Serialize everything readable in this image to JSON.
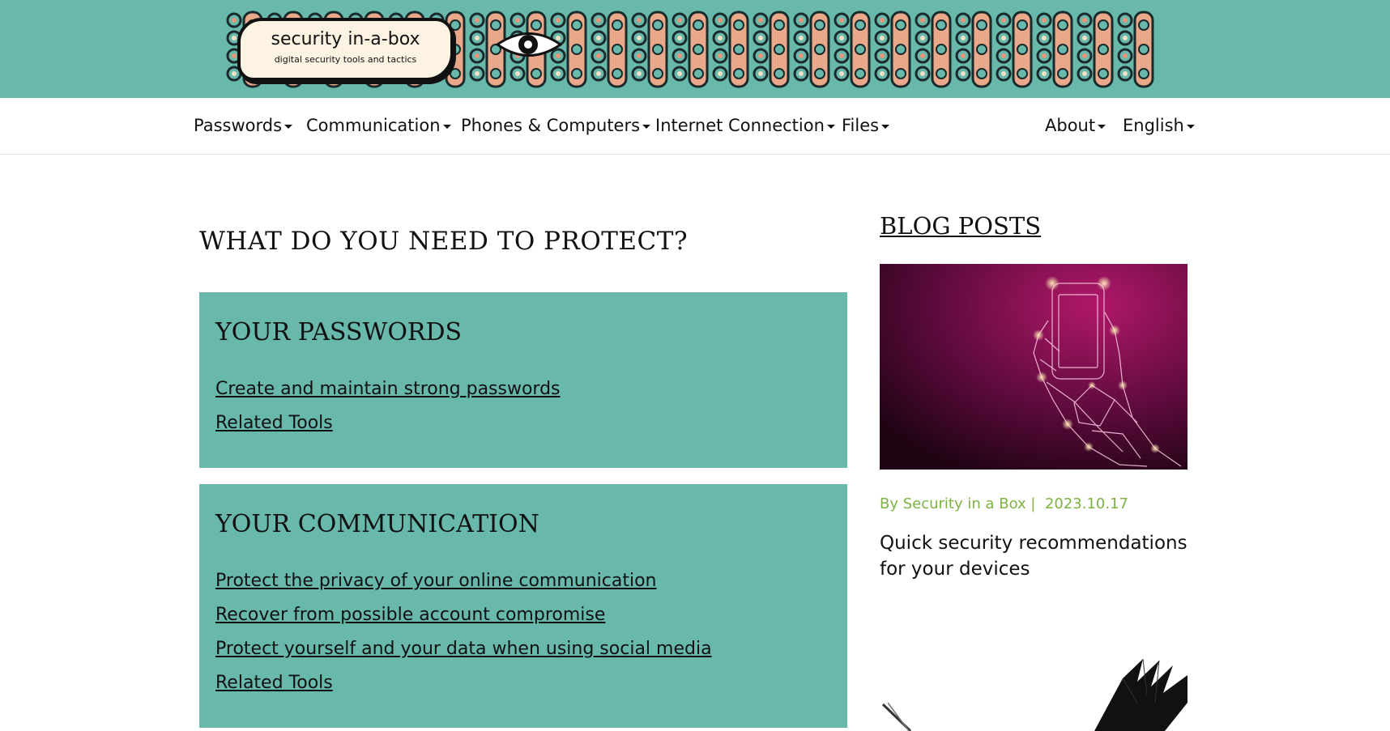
{
  "header": {
    "logo_title": "security in-a-box",
    "logo_subtitle": "digital security tools and tactics",
    "background_color": "#68b8ac"
  },
  "nav": {
    "items": [
      {
        "label": "Passwords"
      },
      {
        "label": "Communication"
      },
      {
        "label": "Phones & Computers"
      },
      {
        "label": "Internet Connection"
      },
      {
        "label": "Files"
      }
    ],
    "right_items": [
      {
        "label": "About"
      },
      {
        "label": "English"
      }
    ]
  },
  "main": {
    "title": "WHAT DO YOU NEED TO PROTECT?",
    "sections": [
      {
        "heading": "YOUR PASSWORDS",
        "links": [
          "Create and maintain strong passwords",
          "Related Tools"
        ]
      },
      {
        "heading": "YOUR COMMUNICATION",
        "links": [
          "Protect the privacy of your online communication",
          "Recover from possible account compromise",
          "Protect yourself and your data when using social media",
          "Related Tools"
        ]
      }
    ],
    "section_color": "#68b8ac"
  },
  "sidebar": {
    "heading": "BLOG POSTS",
    "posts": [
      {
        "author": "By Security in a Box |",
        "date": "2023.10.17",
        "title": "Quick security recommendations for your devices"
      }
    ],
    "byline_color": "#7cb342"
  }
}
